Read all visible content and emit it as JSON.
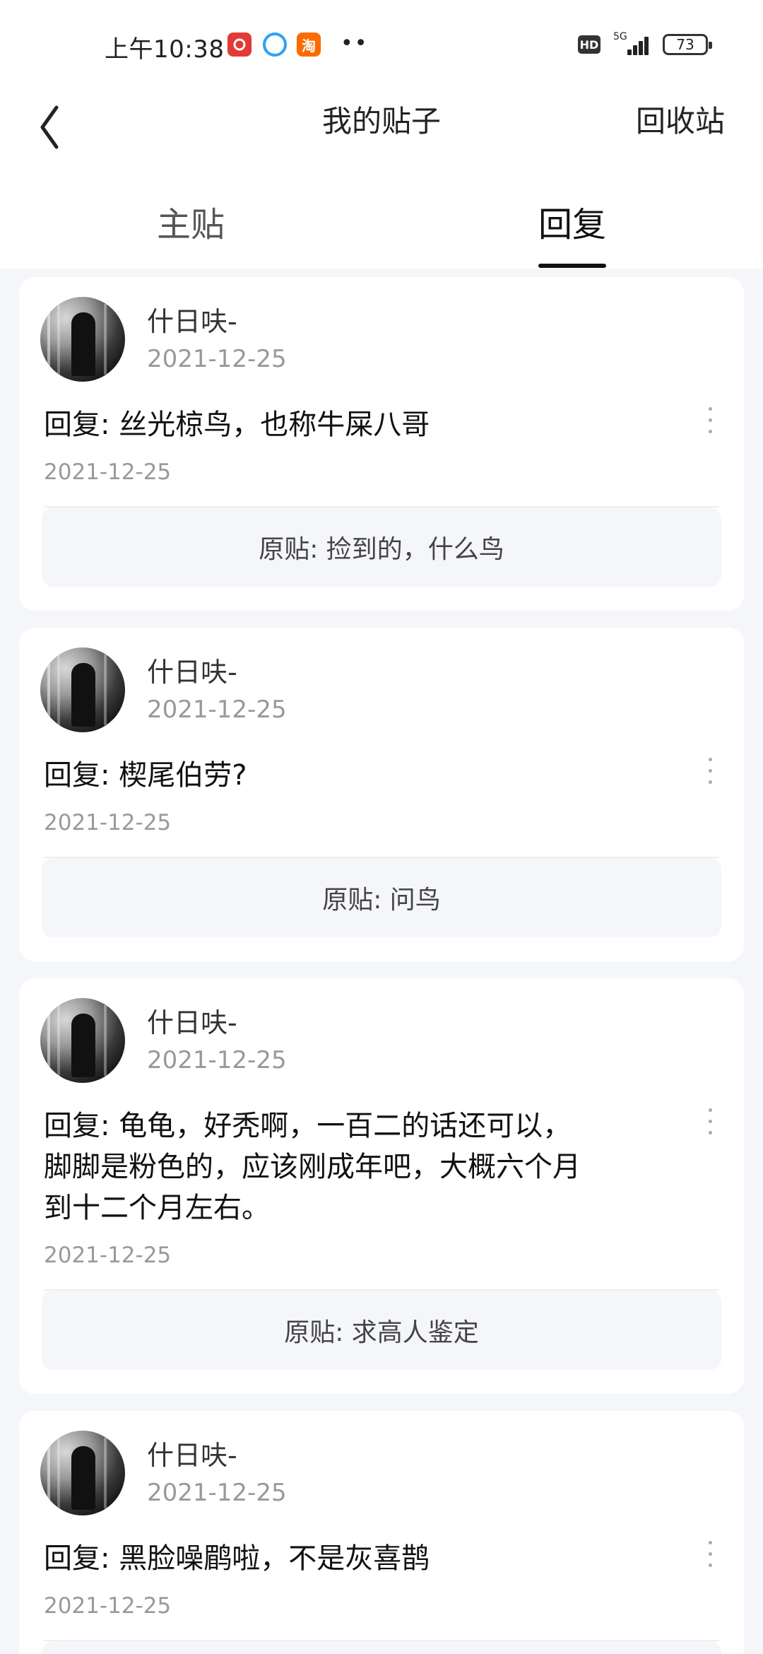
{
  "status_bar": {
    "time": "上午10:38",
    "apps": [
      "netease-music-icon",
      "qq-browser-icon",
      "taobao-icon"
    ],
    "taobao_glyph": "淘",
    "more_dots": "••",
    "hd": "HD",
    "network": "5G",
    "battery": "73"
  },
  "header": {
    "title": "我的贴子",
    "recycle": "回收站"
  },
  "tabs": [
    {
      "label": "主贴",
      "active": false
    },
    {
      "label": "回复",
      "active": true
    }
  ],
  "posts": [
    {
      "username": "什日呋-",
      "user_date": "2021-12-25",
      "reply": "回复: 丝光椋鸟，也称牛屎八哥",
      "reply_date": "2021-12-25",
      "original": "原贴: 捡到的，什么鸟"
    },
    {
      "username": "什日呋-",
      "user_date": "2021-12-25",
      "reply": "回复: 楔尾伯劳?",
      "reply_date": "2021-12-25",
      "original": "原贴: 问鸟"
    },
    {
      "username": "什日呋-",
      "user_date": "2021-12-25",
      "reply": "回复: 龟龟，好秃啊，一百二的话还可以，\n脚脚是粉色的，应该刚成年吧，大概六个月\n到十二个月左右。",
      "reply_date": "2021-12-25",
      "original": "原贴: 求高人鉴定"
    },
    {
      "username": "什日呋-",
      "user_date": "2021-12-25",
      "reply": "回复: 黑脸噪鹛啦，不是灰喜鹊",
      "reply_date": "2021-12-25",
      "original": ""
    }
  ],
  "colors": {
    "background": "#f5f6fa",
    "card": "#ffffff",
    "text_primary": "#111111",
    "text_secondary": "#999999"
  }
}
